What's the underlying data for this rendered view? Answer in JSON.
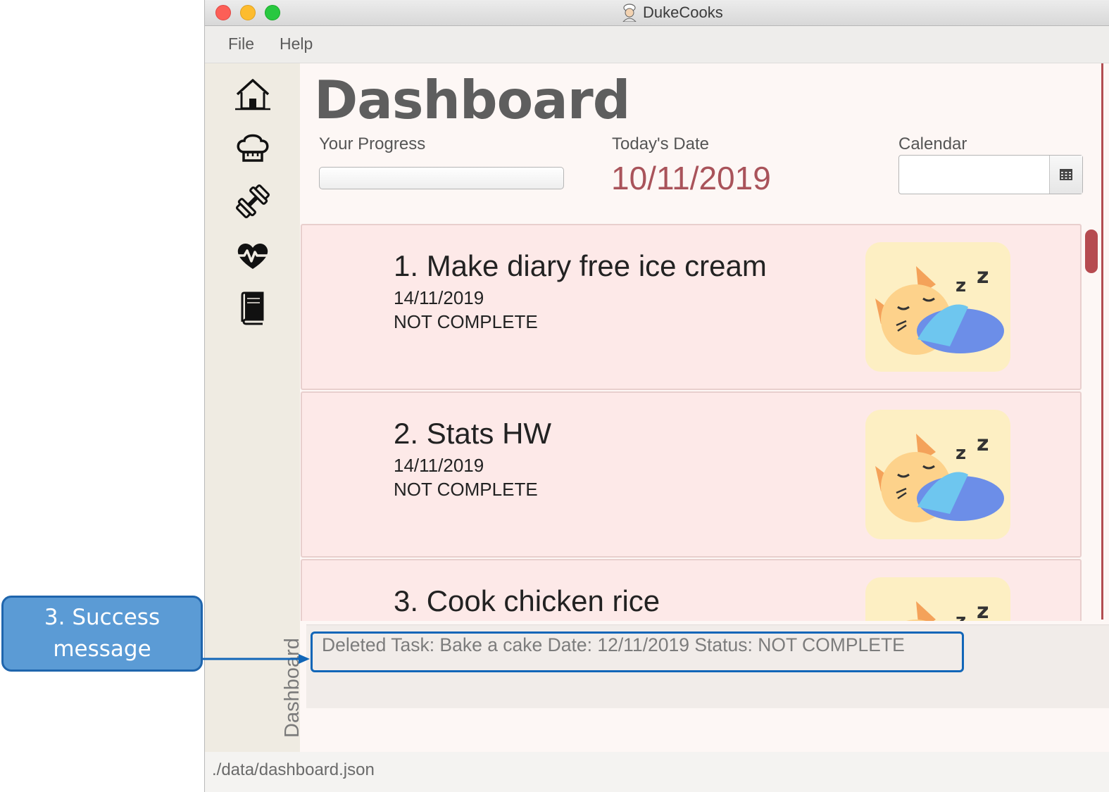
{
  "annotation": {
    "line1": "3. Success",
    "line2": "message"
  },
  "window": {
    "title": "DukeCooks"
  },
  "menu": {
    "file": "File",
    "help": "Help"
  },
  "sidebar": {
    "items": [
      {
        "icon": "home-icon"
      },
      {
        "icon": "chef-hat-icon"
      },
      {
        "icon": "dumbbell-icon"
      },
      {
        "icon": "heartbeat-icon"
      },
      {
        "icon": "book-icon"
      }
    ],
    "vertical_label": "Dashboard"
  },
  "dashboard": {
    "title": "Dashboard",
    "progress_label": "Your Progress",
    "progress_fraction": 0,
    "today_label": "Today's Date",
    "today_value": "10/11/2019",
    "calendar_label": "Calendar",
    "calendar_value": ""
  },
  "tasks": [
    {
      "title": "1.  Make diary free ice cream",
      "date": "14/11/2019",
      "status": "NOT COMPLETE"
    },
    {
      "title": "2.  Stats HW",
      "date": "14/11/2019",
      "status": "NOT COMPLETE"
    },
    {
      "title": "3.  Cook chicken rice",
      "date": "",
      "status": ""
    }
  ],
  "output": {
    "message": "Deleted Task: Bake a cake Date: 12/11/2019 Status: NOT COMPLETE"
  },
  "status_bar": {
    "path": "./data/dashboard.json"
  },
  "colors": {
    "accent": "#b24e52",
    "date": "#a9535a",
    "card": "#fde9e8",
    "annotation": "#5b9bd5"
  }
}
